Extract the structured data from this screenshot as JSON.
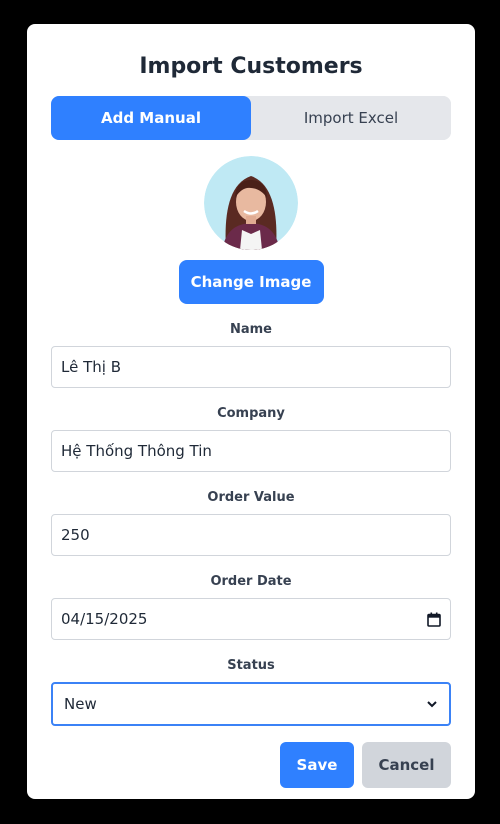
{
  "dialog": {
    "title": "Import Customers"
  },
  "tabs": [
    {
      "label": "Add Manual",
      "active": true
    },
    {
      "label": "Import Excel",
      "active": false
    }
  ],
  "avatar": {
    "icon": "user-photo"
  },
  "change_image_label": "Change Image",
  "form": {
    "name": {
      "label": "Name",
      "value": "Lê Thị B"
    },
    "company": {
      "label": "Company",
      "value": "Hệ Thống Thông Tin"
    },
    "order_value": {
      "label": "Order Value",
      "value": "250"
    },
    "order_date": {
      "label": "Order Date",
      "value": "04/15/2025"
    },
    "status": {
      "label": "Status",
      "value": "New"
    }
  },
  "actions": {
    "save_label": "Save",
    "cancel_label": "Cancel"
  },
  "colors": {
    "primary": "#2f80ff",
    "secondary": "#d1d5db",
    "focus": "#3b82f6"
  }
}
